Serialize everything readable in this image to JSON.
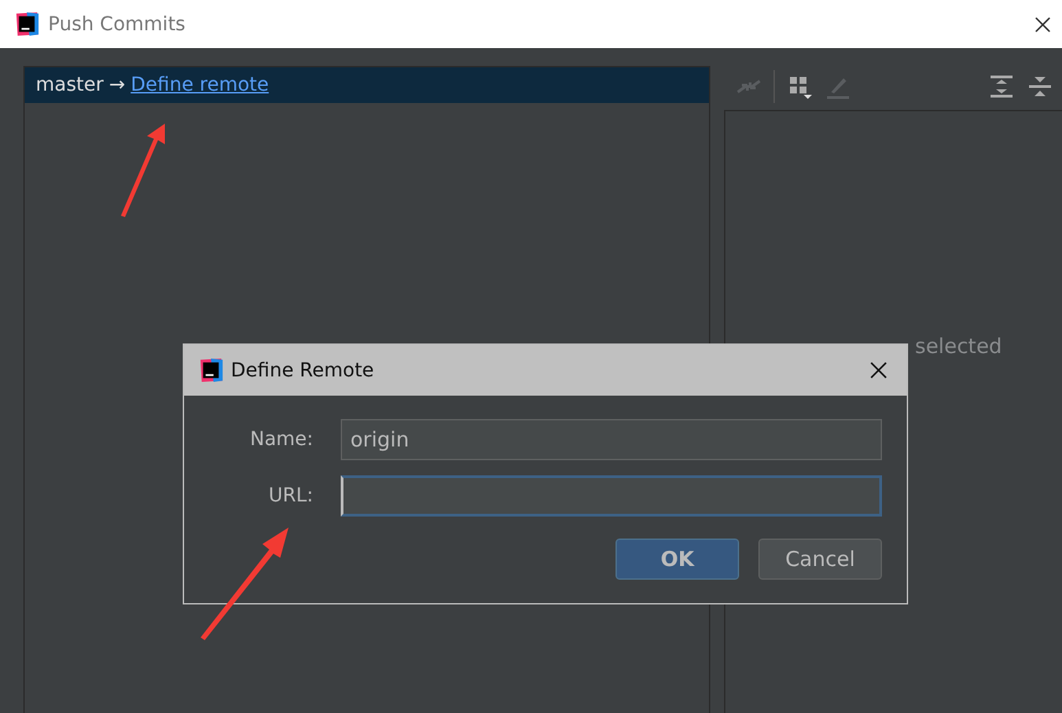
{
  "window": {
    "title": "Push Commits"
  },
  "push_tree": {
    "rows": [
      {
        "branch": "master",
        "arrow": "→",
        "remote_link": "Define remote",
        "selected": true
      }
    ]
  },
  "details_panel": {
    "empty_text": "selected"
  },
  "dialog": {
    "title": "Define Remote",
    "fields": [
      {
        "label": "Name:",
        "value": "origin",
        "focused": false
      },
      {
        "label": "URL:",
        "focused": true
      }
    ],
    "buttons": [
      {
        "label": "OK",
        "default": true
      },
      {
        "label": "Cancel",
        "default": false
      }
    ]
  }
}
